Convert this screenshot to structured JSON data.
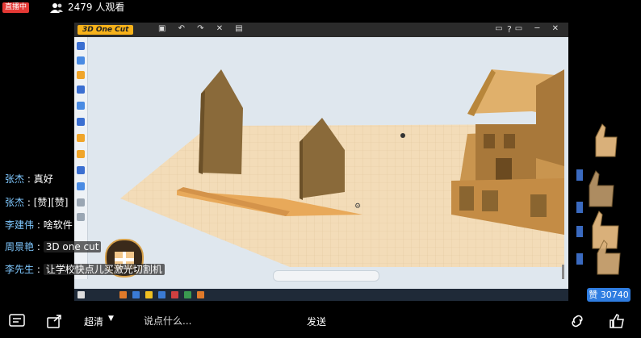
{
  "header": {
    "live_label": "直播中",
    "viewers": "2479 人观看"
  },
  "screen": {
    "app_logo": "3D One Cut",
    "toolbar_icons": "▣ ↶ ↷ ✕ ▤",
    "help": "?",
    "window_controls": "▭ ▭ ─ ✕"
  },
  "chat": [
    {
      "user": "张杰",
      "message": "真好"
    },
    {
      "user": "张杰",
      "message": "[赞][赞]"
    },
    {
      "user": "李建伟",
      "message": "啥软件"
    },
    {
      "user": "周景艳",
      "message": "3D one cut"
    },
    {
      "user": "李先生",
      "message": "让学校快点儿买激光切割机"
    }
  ],
  "likes": {
    "label": "赞 30740"
  },
  "bottom": {
    "quality": "超清",
    "quality_arrow": "▼",
    "comment_placeholder": "说点什么...",
    "send": "发送"
  },
  "colors": {
    "live_red": "#e53935",
    "accent_blue": "#2f7de1",
    "wood": "#b8863b",
    "username": "#7fc8ff"
  }
}
